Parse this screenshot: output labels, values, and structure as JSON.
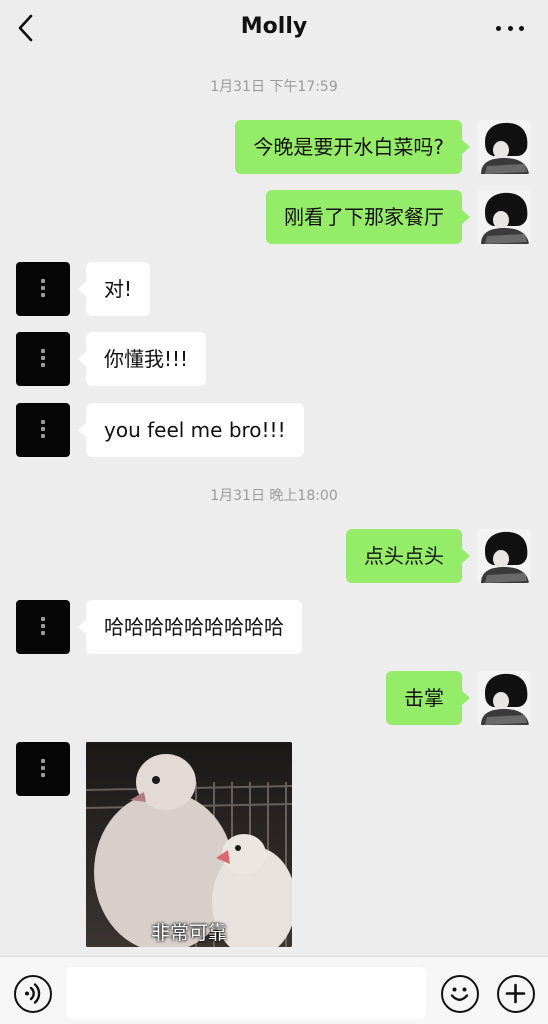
{
  "header": {
    "title": "Molly",
    "back_icon": "chevron-left-icon",
    "more_icon": "more-horizontal-icon"
  },
  "timestamps": [
    "1月31日 下午17:59",
    "1月31日 晚上18:00"
  ],
  "messages": [
    {
      "side": "out",
      "text": "今晚是要开水白菜吗?"
    },
    {
      "side": "out",
      "text": "刚看了下那家餐厅"
    },
    {
      "side": "in",
      "text": "对!"
    },
    {
      "side": "in",
      "text": "你懂我!!!"
    },
    {
      "side": "in",
      "text": "you feel me bro!!!"
    },
    {
      "side": "out",
      "text": "点头点头"
    },
    {
      "side": "in",
      "text": "哈哈哈哈哈哈哈哈哈"
    },
    {
      "side": "out",
      "text": "击掌"
    }
  ],
  "sticker": {
    "caption": "非常可靠"
  },
  "input_bar": {
    "voice_icon": "voice-icon",
    "emoji_icon": "emoji-icon",
    "plus_icon": "plus-icon",
    "text_value": ""
  },
  "colors": {
    "background": "#ededed",
    "outgoing_bubble": "#95ec69",
    "incoming_bubble": "#ffffff",
    "timestamp": "#9a9a9a"
  }
}
